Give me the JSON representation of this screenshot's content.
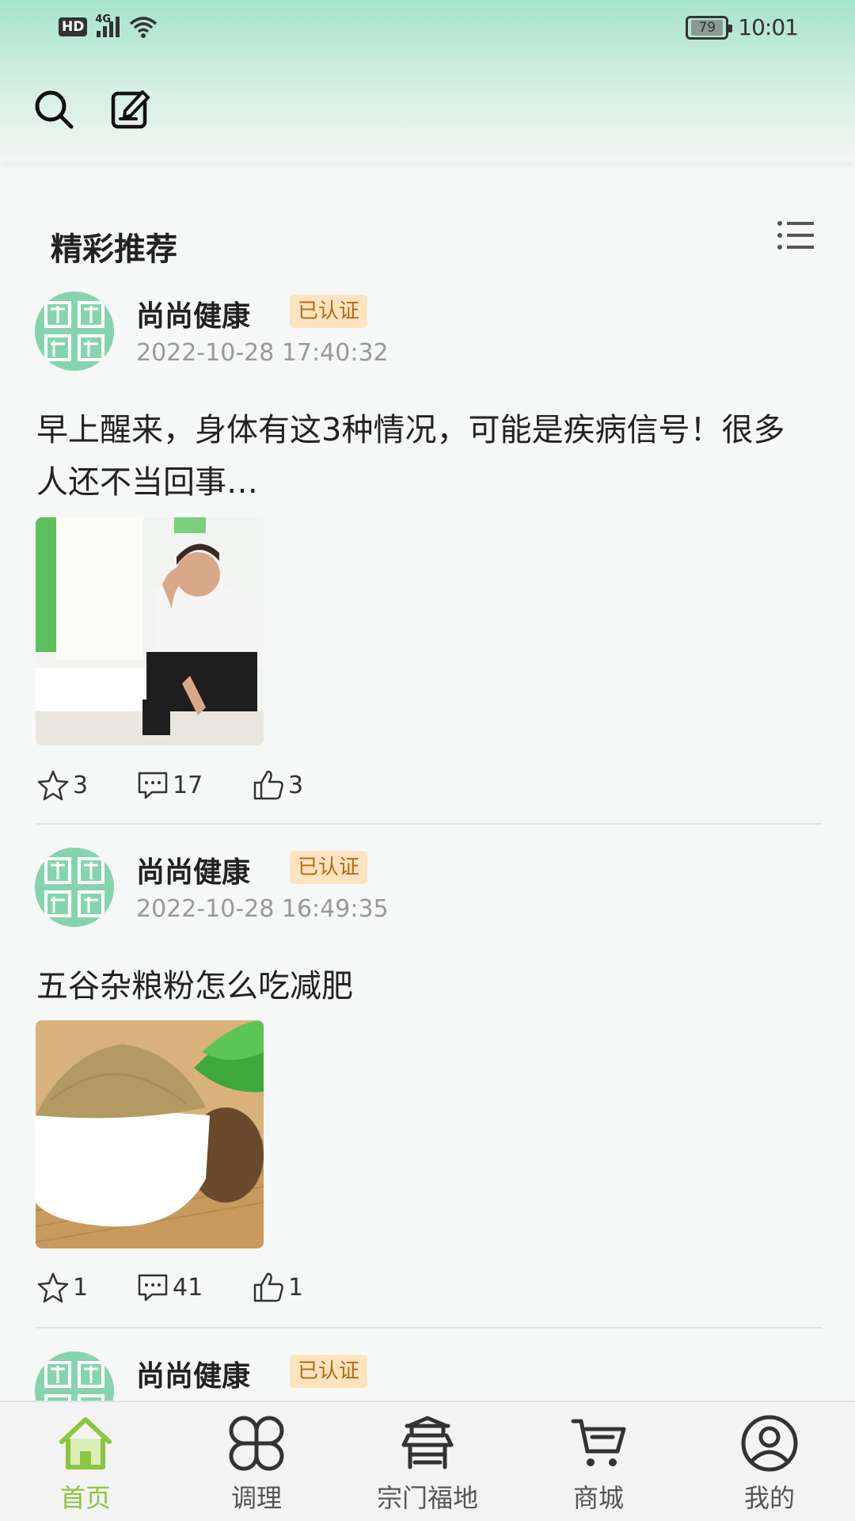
{
  "status_bar": {
    "hd": "HD",
    "network": "4G",
    "battery": "79",
    "time": "10:01"
  },
  "header": {
    "search_icon": "search-icon",
    "edit_icon": "edit-icon"
  },
  "section": {
    "title": "精彩推荐",
    "list_icon": "list-icon"
  },
  "posts": [
    {
      "author": "尚尚健康",
      "badge": "已认证",
      "time": "2022-10-28 17:40:32",
      "title": "早上醒来，身体有这3种情况，可能是疾病信号！很多人还不当回事…",
      "image": "man-holding-head-photo",
      "favorites": "3",
      "comments": "17",
      "likes": "3"
    },
    {
      "author": "尚尚健康",
      "badge": "已认证",
      "time": "2022-10-28 16:49:35",
      "title": "五谷杂粮粉怎么吃减肥",
      "image": "grain-powder-bowl-photo",
      "favorites": "1",
      "comments": "41",
      "likes": "1"
    },
    {
      "author": "尚尚健康",
      "badge": "已认证"
    }
  ],
  "bottom_nav": [
    {
      "label": "首页",
      "icon": "home-icon",
      "active": true
    },
    {
      "label": "调理",
      "icon": "clover-icon",
      "active": false
    },
    {
      "label": "宗门福地",
      "icon": "temple-icon",
      "active": false
    },
    {
      "label": "商城",
      "icon": "cart-icon",
      "active": false
    },
    {
      "label": "我的",
      "icon": "user-icon",
      "active": false
    }
  ],
  "colors": {
    "accent": "#8cc53f",
    "header_top": "#a6e3cc",
    "badge_bg": "#fde3bf",
    "badge_text": "#b36b13",
    "avatar": "#86d4ad"
  }
}
